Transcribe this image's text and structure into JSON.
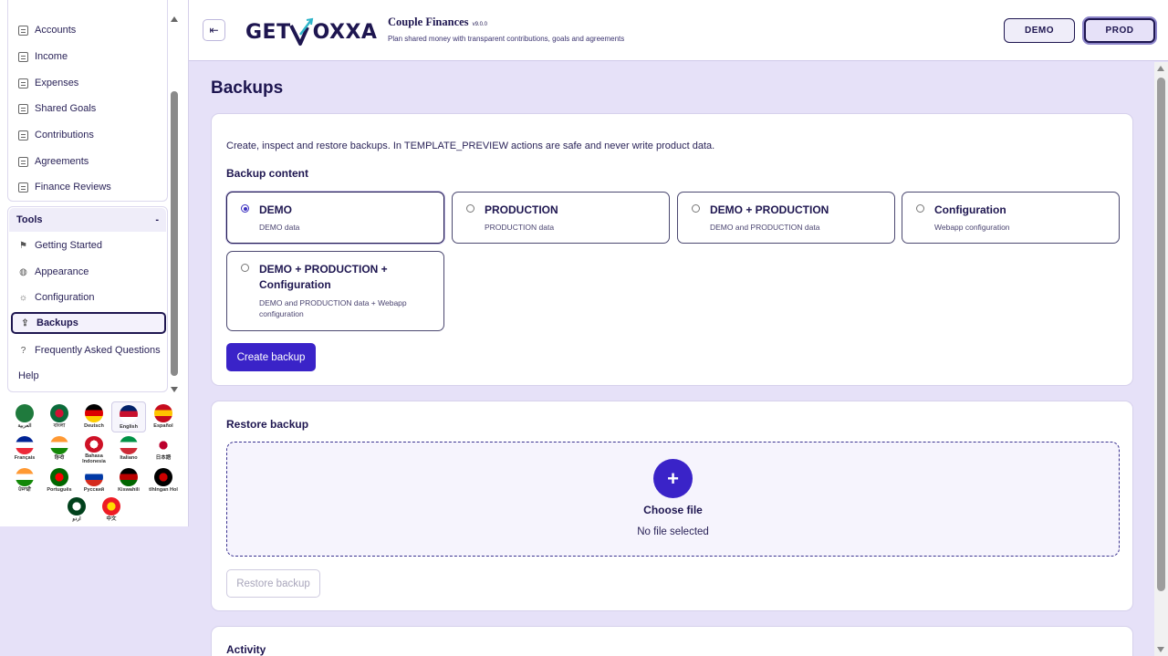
{
  "sidebar": {
    "items": [
      {
        "label": "Accounts",
        "icon": "list-icon"
      },
      {
        "label": "Income",
        "icon": "list-icon"
      },
      {
        "label": "Expenses",
        "icon": "list-icon"
      },
      {
        "label": "Shared Goals",
        "icon": "list-icon"
      },
      {
        "label": "Contributions",
        "icon": "list-icon"
      },
      {
        "label": "Agreements",
        "icon": "list-icon"
      },
      {
        "label": "Finance Reviews",
        "icon": "list-icon"
      }
    ],
    "tools": {
      "title": "Tools",
      "toggle": "-",
      "items": [
        {
          "label": "Getting Started",
          "icon": "flag-icon"
        },
        {
          "label": "Appearance",
          "icon": "palette-icon"
        },
        {
          "label": "Configuration",
          "icon": "gear-icon"
        },
        {
          "label": "Backups",
          "icon": "upload-icon",
          "active": true
        },
        {
          "label": "Frequently Asked Questions",
          "icon": "help-circle-icon"
        },
        {
          "label": "Help",
          "icon": ""
        }
      ]
    },
    "languages": [
      {
        "label": "العربية",
        "colors": [
          "#1f7a3d",
          "#1f7a3d"
        ]
      },
      {
        "label": "বাংলা",
        "colors": [
          "#0b6b3a",
          "#d21034"
        ]
      },
      {
        "label": "Deutsch",
        "colors": [
          "#000000",
          "#dd0000",
          "#ffce00"
        ]
      },
      {
        "label": "English",
        "colors": [
          "#012169",
          "#c8102e",
          "#ffffff"
        ],
        "selected": true
      },
      {
        "label": "Español",
        "colors": [
          "#c60b1e",
          "#ffc400",
          "#c60b1e"
        ]
      },
      {
        "label": "Français",
        "colors": [
          "#002395",
          "#ffffff",
          "#ed2939"
        ]
      },
      {
        "label": "हिन्दी",
        "colors": [
          "#ff9933",
          "#ffffff",
          "#138808"
        ]
      },
      {
        "label": "Bahasa Indonesia",
        "colors": [
          "#ce1126",
          "#ffffff"
        ]
      },
      {
        "label": "Italiano",
        "colors": [
          "#009246",
          "#ffffff",
          "#ce2b37"
        ]
      },
      {
        "label": "日本語",
        "colors": [
          "#ffffff",
          "#bc002d"
        ]
      },
      {
        "label": "ਪੰਜਾਬੀ",
        "colors": [
          "#ff9933",
          "#ffffff",
          "#138808"
        ]
      },
      {
        "label": "Português",
        "colors": [
          "#006600",
          "#ff0000"
        ]
      },
      {
        "label": "Русский",
        "colors": [
          "#ffffff",
          "#0039a6",
          "#d52b1e"
        ]
      },
      {
        "label": "Kiswahili",
        "colors": [
          "#000000",
          "#bb0000",
          "#006600"
        ]
      },
      {
        "label": "tlhIngan Hol",
        "colors": [
          "#000000",
          "#cc0000"
        ]
      },
      {
        "label": "اردو",
        "colors": [
          "#01411c",
          "#ffffff"
        ]
      },
      {
        "label": "中文",
        "colors": [
          "#ee1c25",
          "#ffde00"
        ]
      }
    ]
  },
  "header": {
    "logo_left": "GET",
    "logo_right": "OXXA",
    "app_title": "Couple Finances",
    "version": "v9.0.0",
    "subtitle": "Plan shared money with transparent contributions, goals and agreements",
    "env_demo": "DEMO",
    "env_prod": "PROD"
  },
  "main": {
    "title": "Backups",
    "intro": "Create, inspect and restore backups. In TEMPLATE_PREVIEW actions are safe and never write product data.",
    "backup_content_title": "Backup content",
    "options": [
      {
        "title": "DEMO",
        "desc": "DEMO data",
        "selected": true
      },
      {
        "title": "PRODUCTION",
        "desc": "PRODUCTION data",
        "selected": false
      },
      {
        "title": "DEMO + PRODUCTION",
        "desc": "DEMO and PRODUCTION data",
        "selected": false
      },
      {
        "title": "Configuration",
        "desc": "Webapp configuration",
        "selected": false
      },
      {
        "title": "DEMO + PRODUCTION + Configuration",
        "desc": "DEMO and PRODUCTION data + Webapp configuration",
        "selected": false
      }
    ],
    "create_button": "Create backup",
    "restore_title": "Restore backup",
    "choose_file": "Choose file",
    "no_file": "No file selected",
    "restore_button": "Restore backup",
    "activity_title": "Activity"
  },
  "colors": {
    "accent": "#3a23c8",
    "navy": "#1e1650",
    "background": "#e6e1f8"
  }
}
